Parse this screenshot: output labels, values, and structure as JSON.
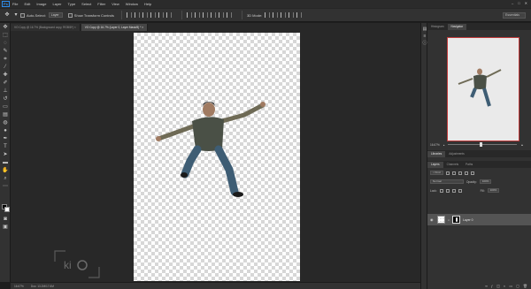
{
  "app": {
    "logo": "Ps"
  },
  "menu": [
    "File",
    "Edit",
    "Image",
    "Layer",
    "Type",
    "Select",
    "Filter",
    "View",
    "Window",
    "Help"
  ],
  "window_controls": [
    "–",
    "□",
    "✕"
  ],
  "options": {
    "auto_select_label": "Auto-Select:",
    "auto_select_value": "Layer",
    "show_transform_label": "Show Transform Controls",
    "mode_3d_label": "3D Mode:",
    "workspace": "Essentials"
  },
  "doc_tabs": [
    {
      "label": "VO Copy @ 16.7% (Background copy, RGB/8*) ×",
      "active": false
    },
    {
      "label": "VO Copy @ 16.7% (Layer 0, Layer Mask/8) * ×",
      "active": true
    }
  ],
  "status": {
    "zoom": "16.67%",
    "doc": "Doc: 13.2M/17.6M"
  },
  "navigator": {
    "tabs": [
      "Histogram",
      "Navigator"
    ],
    "active": "Navigator",
    "zoom": "16.67%"
  },
  "libraries": {
    "tabs": [
      "Libraries",
      "Adjustments"
    ]
  },
  "layers": {
    "tabs": [
      "Layers",
      "Channels",
      "Paths"
    ],
    "active": "Layers",
    "kind_label": "Kind",
    "blend_mode": "Normal",
    "opacity_label": "Opacity:",
    "opacity_value": "100%",
    "lock_label": "Lock:",
    "fill_label": "Fill:",
    "fill_value": "100%",
    "items": [
      {
        "name": "Layer 0"
      }
    ],
    "footer_icons": [
      "link-icon",
      "fx-icon",
      "mask-icon",
      "adjustment-icon",
      "folder-icon",
      "new-layer-icon",
      "trash-icon"
    ]
  },
  "colors": {
    "canvas_bg": "#282828",
    "panel_bg": "#323232",
    "nav_frame": "#c13a3a"
  }
}
